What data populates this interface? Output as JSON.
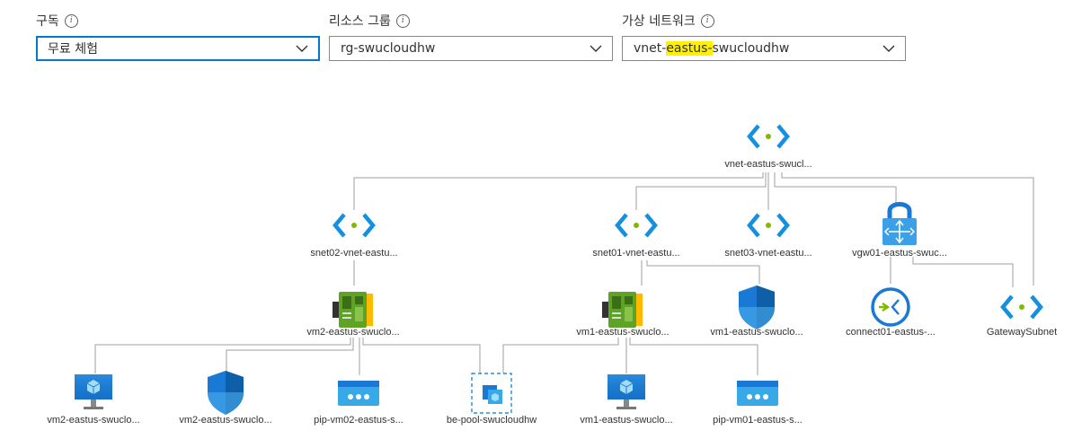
{
  "filters": {
    "subscription": {
      "label": "구독",
      "value": "무료 체험"
    },
    "resource_group": {
      "label": "리소스 그룹",
      "value": "rg-swucloudhw"
    },
    "virtual_network": {
      "label": "가상 네트워크",
      "value_prefix": "vnet-",
      "value_highlight": "eastus-",
      "value_suffix": "swucloudhw"
    }
  },
  "nodes": {
    "vnet": {
      "label": "vnet-eastus-swucl...",
      "icon": "vnet-icon"
    },
    "snet02": {
      "label": "snet02-vnet-eastu...",
      "icon": "subnet-icon"
    },
    "snet01": {
      "label": "snet01-vnet-eastu...",
      "icon": "subnet-icon"
    },
    "snet03": {
      "label": "snet03-vnet-eastu...",
      "icon": "subnet-icon"
    },
    "vgw01": {
      "label": "vgw01-eastus-swuc...",
      "icon": "vpn-gateway-icon"
    },
    "nic2": {
      "label": "vm2-eastus-swuclo...",
      "icon": "nic-icon"
    },
    "nic1": {
      "label": "vm1-eastus-swuclo...",
      "icon": "nic-icon"
    },
    "nsg1": {
      "label": "vm1-eastus-swuclo...",
      "icon": "nsg-icon"
    },
    "connect01": {
      "label": "connect01-eastus-...",
      "icon": "connection-icon"
    },
    "gwsubnet": {
      "label": "GatewaySubnet",
      "icon": "subnet-icon"
    },
    "vm2": {
      "label": "vm2-eastus-swuclo...",
      "icon": "vm-icon"
    },
    "nsg2": {
      "label": "vm2-eastus-swuclo...",
      "icon": "nsg-icon"
    },
    "pip2": {
      "label": "pip-vm02-eastus-s...",
      "icon": "public-ip-icon"
    },
    "bepool": {
      "label": "be-pool-swucloudhw",
      "icon": "backend-pool-icon"
    },
    "vm1": {
      "label": "vm1-eastus-swuclo...",
      "icon": "vm-icon"
    },
    "pip1": {
      "label": "pip-vm01-eastus-s...",
      "icon": "public-ip-icon"
    }
  },
  "colors": {
    "accent": "#0078d4",
    "highlight": "#fff100",
    "line": "#a19f9d"
  }
}
